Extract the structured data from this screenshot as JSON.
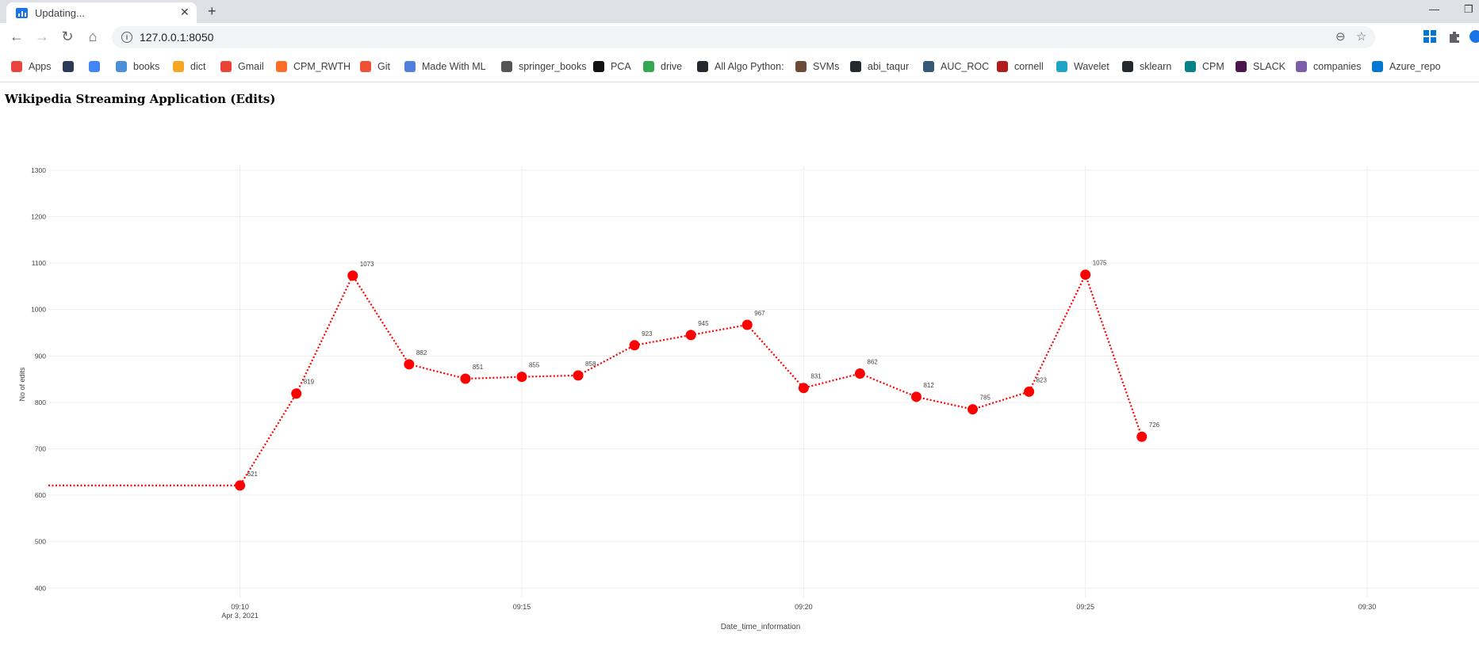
{
  "browser": {
    "tab_title": "Updating...",
    "url": "127.0.0.1:8050",
    "bookmarks": [
      {
        "label": "Apps",
        "icon": "apps-grid-icon",
        "color": "#e8453c"
      },
      {
        "label": "",
        "icon": "shield-logo-icon",
        "color": "#2b3a55"
      },
      {
        "label": "",
        "icon": "translate-icon",
        "color": "#4285f4"
      },
      {
        "label": "books",
        "icon": "globe-icon",
        "color": "#4a90d9"
      },
      {
        "label": "dict",
        "icon": "d-logo-icon",
        "color": "#f5a623"
      },
      {
        "label": "Gmail",
        "icon": "gmail-icon",
        "color": "#ea4335"
      },
      {
        "label": "CPM_RWTH",
        "icon": "gitlab-icon",
        "color": "#fc6d26"
      },
      {
        "label": "Git",
        "icon": "git-icon",
        "color": "#f05033"
      },
      {
        "label": "Made With ML",
        "icon": "ml-icon",
        "color": "#4f7fdb"
      },
      {
        "label": "springer_books",
        "icon": "springer-icon",
        "color": "#555555"
      },
      {
        "label": "PCA",
        "icon": "bolt-icon",
        "color": "#111111"
      },
      {
        "label": "drive",
        "icon": "drive-icon",
        "color": "#34a853"
      },
      {
        "label": "All Algo Python:",
        "icon": "github-icon",
        "color": "#24292e"
      },
      {
        "label": "SVMs",
        "icon": "photo-icon",
        "color": "#6b4a3a"
      },
      {
        "label": "abi_taqur",
        "icon": "github-icon",
        "color": "#24292e"
      },
      {
        "label": "AUC_ROC",
        "icon": "tds-icon",
        "color": "#355876"
      },
      {
        "label": "cornell",
        "icon": "cornell-icon",
        "color": "#b31b1b"
      },
      {
        "label": "Wavelet",
        "icon": "wavelet-icon",
        "color": "#1fa4c9"
      },
      {
        "label": "sklearn",
        "icon": "github-icon",
        "color": "#24292e"
      },
      {
        "label": "CPM",
        "icon": "sharepoint-icon",
        "color": "#038387"
      },
      {
        "label": "SLACK",
        "icon": "slack-icon",
        "color": "#4a154b"
      },
      {
        "label": "companies",
        "icon": "puzzle-icon",
        "color": "#7b5ea7"
      },
      {
        "label": "Azure_repo",
        "icon": "azure-icon",
        "color": "#0078d4"
      }
    ]
  },
  "page": {
    "title": "Wikipedia Streaming Application (Edits)"
  },
  "colors": {
    "series": "#ff0000",
    "grid": "#eeeeee",
    "tick_text": "#444444"
  },
  "chart_data": {
    "type": "line",
    "title": "",
    "xlabel": "Date_time_information",
    "ylabel": "No of edits",
    "x_type": "time",
    "x_range": [
      "2021-04-03 09:06:36",
      "2021-04-03 09:31:59"
    ],
    "ylim": [
      380,
      1310
    ],
    "y_ticks": [
      400,
      500,
      600,
      700,
      800,
      900,
      1000,
      1100,
      1200,
      1300
    ],
    "x_ticks": [
      {
        "time": "2021-04-03 09:10",
        "label": "09:10",
        "sublabel": "Apr 3, 2021"
      },
      {
        "time": "2021-04-03 09:15",
        "label": "09:15",
        "sublabel": ""
      },
      {
        "time": "2021-04-03 09:20",
        "label": "09:20",
        "sublabel": ""
      },
      {
        "time": "2021-04-03 09:25",
        "label": "09:25",
        "sublabel": ""
      },
      {
        "time": "2021-04-03 09:30",
        "label": "09:30",
        "sublabel": ""
      }
    ],
    "line_style": "dotted",
    "grid": true,
    "legend": "none",
    "series": [
      {
        "points": [
          {
            "x": "2021-04-03 09:06:36",
            "y": 621,
            "label": "",
            "marker": false
          },
          {
            "x": "2021-04-03 09:10",
            "y": 621,
            "label": "621",
            "marker": true
          },
          {
            "x": "2021-04-03 09:11",
            "y": 819,
            "label": "819",
            "marker": true
          },
          {
            "x": "2021-04-03 09:12",
            "y": 1073,
            "label": "1073",
            "marker": true
          },
          {
            "x": "2021-04-03 09:13",
            "y": 882,
            "label": "882",
            "marker": true
          },
          {
            "x": "2021-04-03 09:14",
            "y": 851,
            "label": "851",
            "marker": true
          },
          {
            "x": "2021-04-03 09:15",
            "y": 855,
            "label": "855",
            "marker": true
          },
          {
            "x": "2021-04-03 09:16",
            "y": 858,
            "label": "858",
            "marker": true
          },
          {
            "x": "2021-04-03 09:17",
            "y": 923,
            "label": "923",
            "marker": true
          },
          {
            "x": "2021-04-03 09:18",
            "y": 945,
            "label": "945",
            "marker": true
          },
          {
            "x": "2021-04-03 09:19",
            "y": 967,
            "label": "967",
            "marker": true
          },
          {
            "x": "2021-04-03 09:20",
            "y": 831,
            "label": "831",
            "marker": true
          },
          {
            "x": "2021-04-03 09:21",
            "y": 862,
            "label": "862",
            "marker": true
          },
          {
            "x": "2021-04-03 09:22",
            "y": 812,
            "label": "812",
            "marker": true
          },
          {
            "x": "2021-04-03 09:23",
            "y": 785,
            "label": "785",
            "marker": true
          },
          {
            "x": "2021-04-03 09:24",
            "y": 823,
            "label": "823",
            "marker": true
          },
          {
            "x": "2021-04-03 09:25",
            "y": 1075,
            "label": "1075",
            "marker": true
          },
          {
            "x": "2021-04-03 09:26",
            "y": 726,
            "label": "726",
            "marker": true
          }
        ]
      }
    ]
  }
}
